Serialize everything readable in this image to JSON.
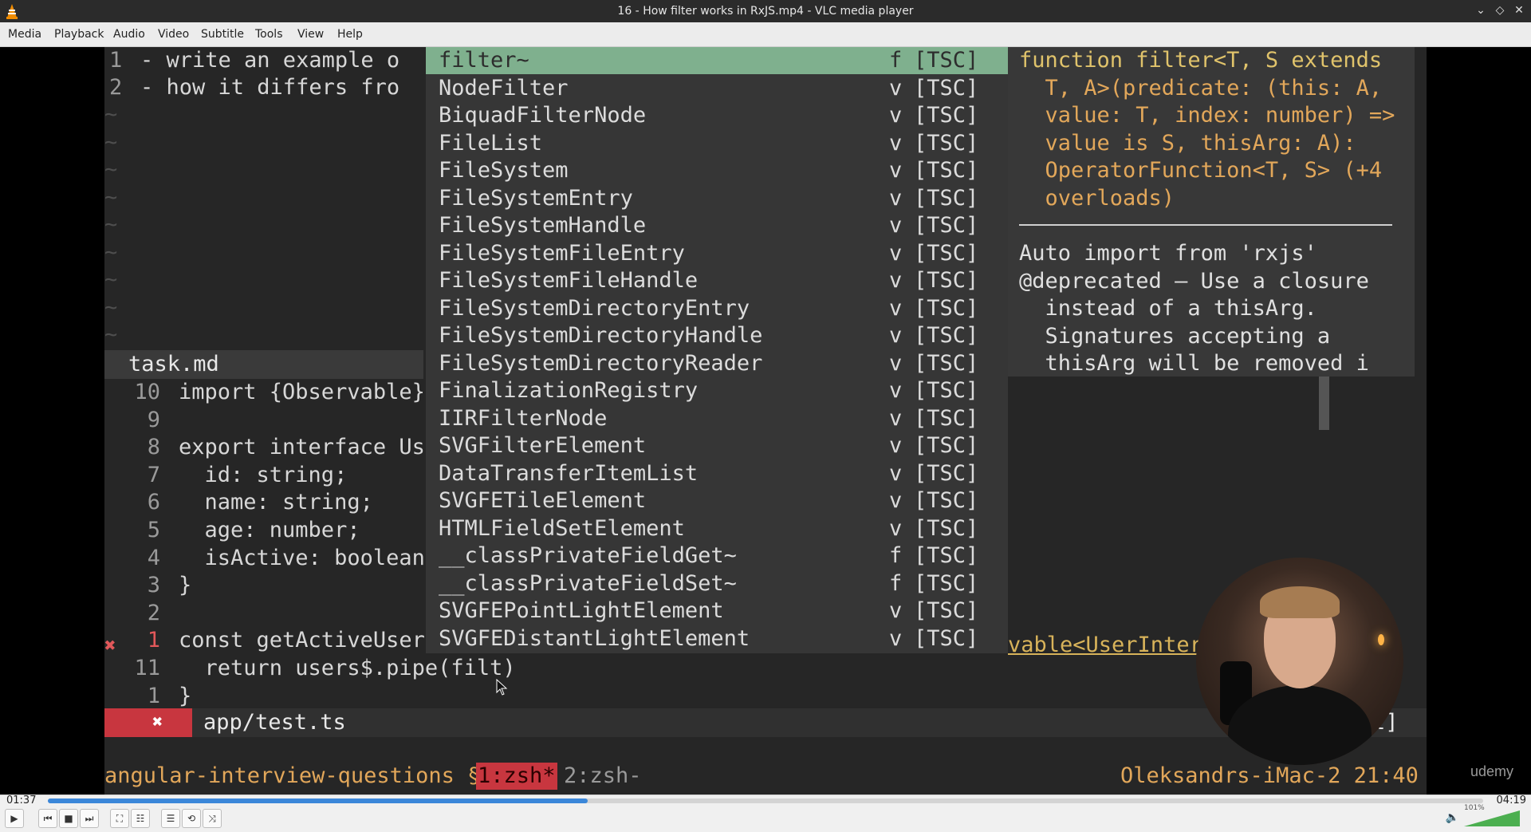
{
  "window": {
    "title": "16 - How filter works in RxJS.mp4 - VLC media player"
  },
  "menu": [
    "Media",
    "Playback",
    "Audio",
    "Video",
    "Subtitle",
    "Tools",
    "View",
    "Help"
  ],
  "editor": {
    "top_lines": [
      {
        "num": "1",
        "text": "- write an example o"
      },
      {
        "num": "2",
        "text": "- how it differs fro"
      }
    ],
    "top_status": "task.md",
    "code": [
      {
        "num": "10",
        "text": "import {Observable}"
      },
      {
        "num": "9",
        "text": ""
      },
      {
        "num": "8",
        "text": "export interface Use"
      },
      {
        "num": "7",
        "text": "  id: string;"
      },
      {
        "num": "6",
        "text": "  name: string;"
      },
      {
        "num": "5",
        "text": "  age: number;"
      },
      {
        "num": "4",
        "text": "  isActive: boolean"
      },
      {
        "num": "3",
        "text": "}"
      },
      {
        "num": "2",
        "text": ""
      },
      {
        "num": "1",
        "text": "const getActiveUsers"
      },
      {
        "num": "11",
        "text": "  return users$.pipe(filt)"
      },
      {
        "num": "1",
        "text": "}"
      }
    ],
    "error_marker": "✖",
    "overflow_text": "vable<UserInter",
    "bottom_status": {
      "icon": "✖",
      "file": "app/test.ts",
      "right": "t]"
    },
    "tmux": {
      "session": "angular-interview-questions §",
      "win1": "1:zsh*",
      "win2": "2:zsh-",
      "host": "Oleksandrs-iMac-2 21:40"
    }
  },
  "completion": [
    {
      "name": "filter~",
      "kind": "f",
      "source": "[TSC]"
    },
    {
      "name": "NodeFilter",
      "kind": "v",
      "source": "[TSC]"
    },
    {
      "name": "BiquadFilterNode",
      "kind": "v",
      "source": "[TSC]"
    },
    {
      "name": "FileList",
      "kind": "v",
      "source": "[TSC]"
    },
    {
      "name": "FileSystem",
      "kind": "v",
      "source": "[TSC]"
    },
    {
      "name": "FileSystemEntry",
      "kind": "v",
      "source": "[TSC]"
    },
    {
      "name": "FileSystemHandle",
      "kind": "v",
      "source": "[TSC]"
    },
    {
      "name": "FileSystemFileEntry",
      "kind": "v",
      "source": "[TSC]"
    },
    {
      "name": "FileSystemFileHandle",
      "kind": "v",
      "source": "[TSC]"
    },
    {
      "name": "FileSystemDirectoryEntry",
      "kind": "v",
      "source": "[TSC]"
    },
    {
      "name": "FileSystemDirectoryHandle",
      "kind": "v",
      "source": "[TSC]"
    },
    {
      "name": "FileSystemDirectoryReader",
      "kind": "v",
      "source": "[TSC]"
    },
    {
      "name": "FinalizationRegistry",
      "kind": "v",
      "source": "[TSC]"
    },
    {
      "name": "IIRFilterNode",
      "kind": "v",
      "source": "[TSC]"
    },
    {
      "name": "SVGFilterElement",
      "kind": "v",
      "source": "[TSC]"
    },
    {
      "name": "DataTransferItemList",
      "kind": "v",
      "source": "[TSC]"
    },
    {
      "name": "SVGFETileElement",
      "kind": "v",
      "source": "[TSC]"
    },
    {
      "name": "HTMLFieldSetElement",
      "kind": "v",
      "source": "[TSC]"
    },
    {
      "name": "__classPrivateFieldGet~",
      "kind": "f",
      "source": "[TSC]"
    },
    {
      "name": "__classPrivateFieldSet~",
      "kind": "f",
      "source": "[TSC]"
    },
    {
      "name": "SVGFEPointLightElement",
      "kind": "v",
      "source": "[TSC]"
    },
    {
      "name": "SVGFEDistantLightElement",
      "kind": "v",
      "source": "[TSC]"
    }
  ],
  "doc": {
    "signature": [
      "function filter<T, S extends",
      "  T, A>(predicate: (this: A,",
      "  value: T, index: number) =>",
      "  value is S, thisArg: A):",
      "  OperatorFunction<T, S> (+4",
      "  overloads)"
    ],
    "notes": [
      "Auto import from 'rxjs'",
      "@deprecated — Use a closure",
      "  instead of a thisArg.",
      "  Signatures accepting a",
      "  thisArg will be removed i"
    ]
  },
  "watermark": "udemy",
  "player": {
    "elapsed": "01:37",
    "total": "04:19",
    "progress": 0.376,
    "volume_label": "101%",
    "volume": 1.0
  },
  "colors": {
    "accent": "#3b87d9",
    "selection": "#7fb08e",
    "error": "#c8363f"
  }
}
